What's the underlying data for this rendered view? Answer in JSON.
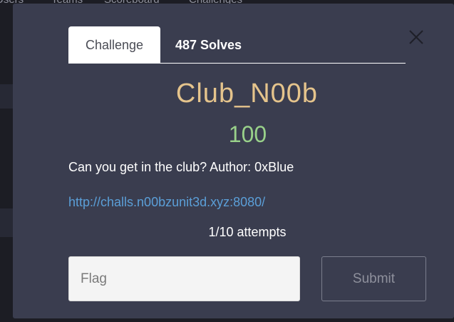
{
  "backdrop": {
    "nav_items": [
      "Users",
      "Teams",
      "Scoreboard",
      "Challenges"
    ]
  },
  "modal": {
    "close_icon": "close-icon",
    "tabs": [
      {
        "label": "Challenge",
        "active": true
      },
      {
        "label": "487 Solves",
        "active": false
      }
    ],
    "challenge": {
      "name": "Club_N00b",
      "points": "100",
      "description": "Can you get in the club? Author: 0xBlue",
      "link": "http://challs.n00bzunit3d.xyz:8080/",
      "attempts": "1/10 attempts"
    },
    "flag_input": {
      "placeholder": "Flag",
      "value": ""
    },
    "submit_label": "Submit"
  },
  "colors": {
    "modal_bg": "#3a3d4f",
    "title": "#e5c48c",
    "points": "#99d18a",
    "link": "#5b9fd8"
  }
}
